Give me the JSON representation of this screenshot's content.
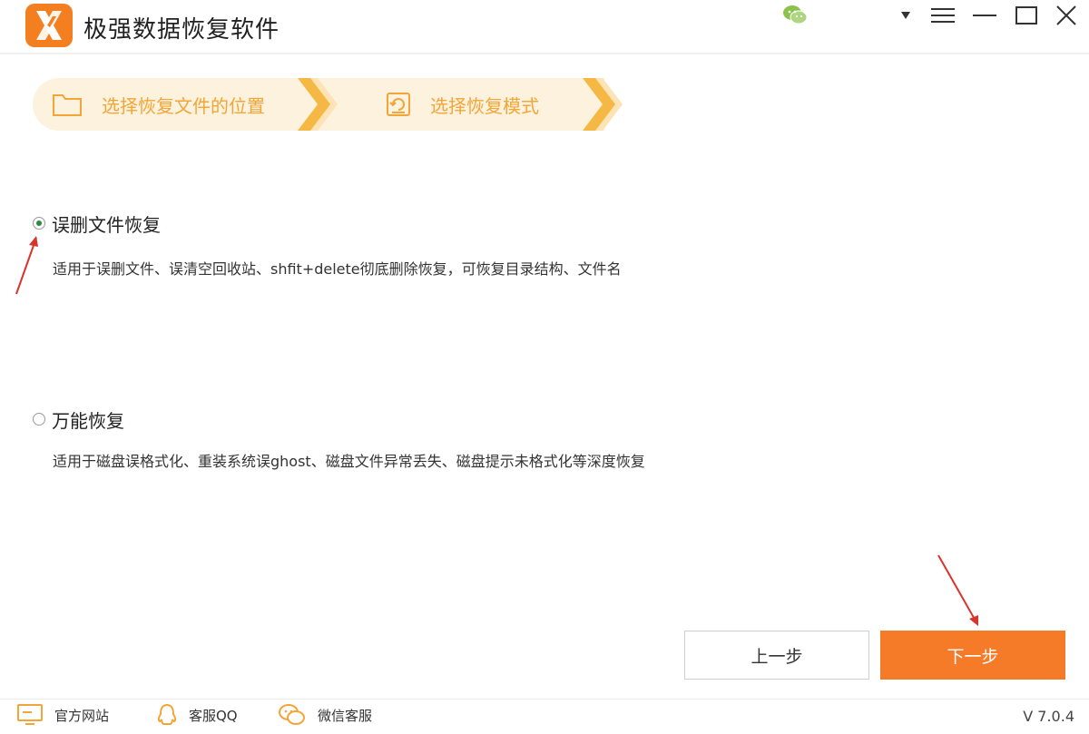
{
  "app": {
    "title": "极强数据恢复软件",
    "accent": "#f57b28",
    "step_bg": "#fdf2dd",
    "step_text": "#f3a537"
  },
  "window_controls": [
    {
      "name": "dropdown-icon"
    },
    {
      "name": "menu-icon"
    },
    {
      "name": "minimize-icon"
    },
    {
      "name": "maximize-icon"
    },
    {
      "name": "close-icon"
    }
  ],
  "steps": [
    {
      "label": "选择恢复文件的位置",
      "icon": "folder-icon"
    },
    {
      "label": "选择恢复模式",
      "icon": "disk-restore-icon"
    }
  ],
  "options": [
    {
      "title": "误删文件恢复",
      "desc": "适用于误删文件、误清空回收站、shfit+delete彻底删除恢复，可恢复目录结构、文件名",
      "checked": true
    },
    {
      "title": "万能恢复",
      "desc": "适用于磁盘误格式化、重装系统误ghost、磁盘文件异常丢失、磁盘提示未格式化等深度恢复",
      "checked": false
    }
  ],
  "buttons": {
    "prev": "上一步",
    "next": "下一步"
  },
  "footer": {
    "website": "官方网站",
    "qq": "客服QQ",
    "wechat": "微信客服",
    "version": "V 7.0.4"
  }
}
